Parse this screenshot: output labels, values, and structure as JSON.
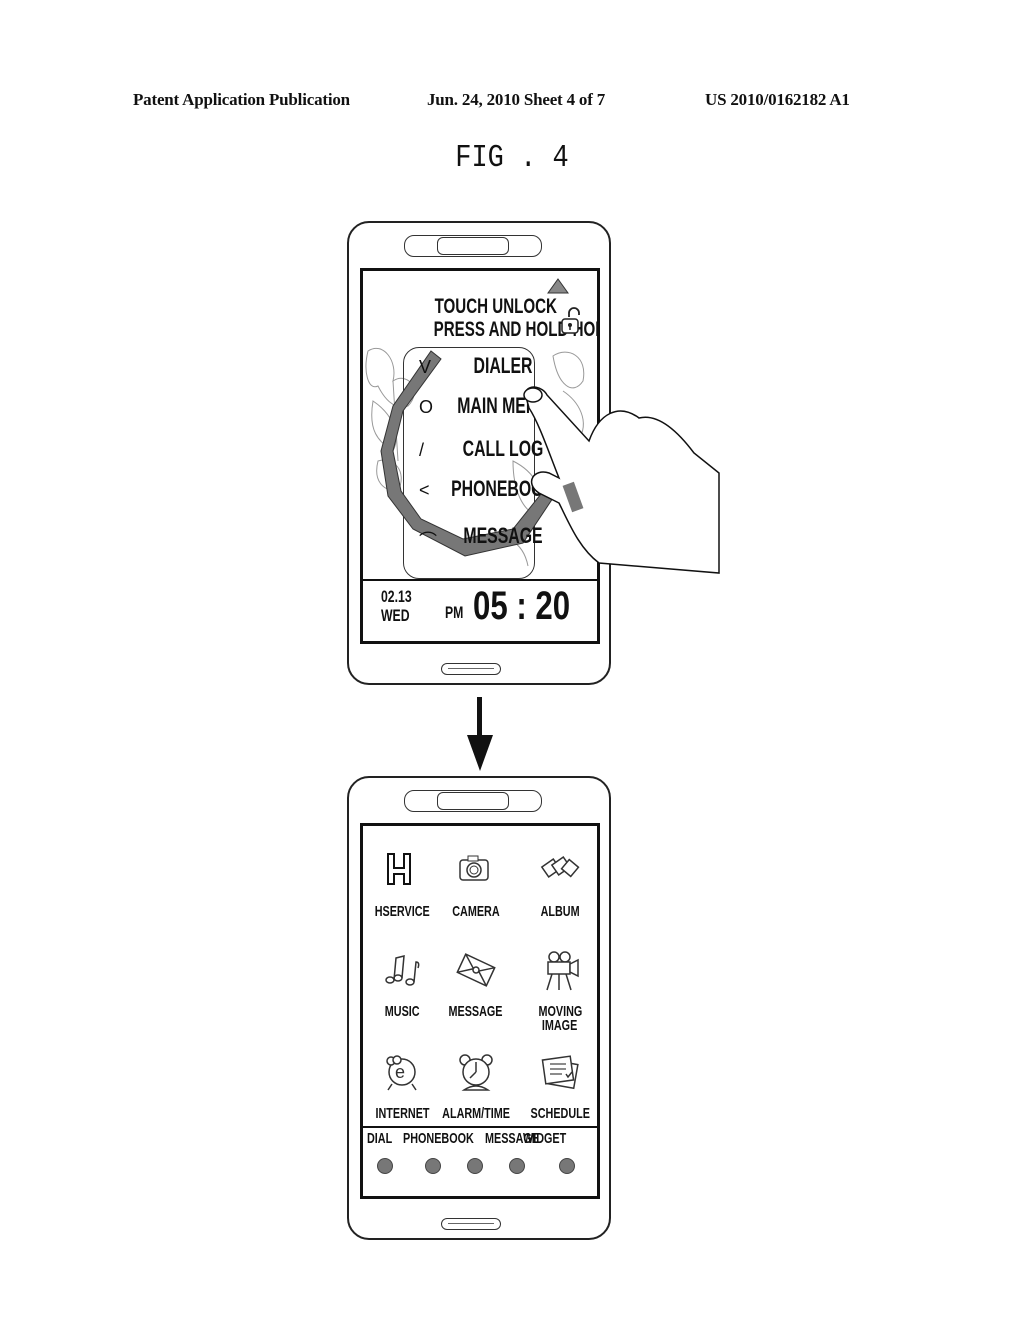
{
  "header": {
    "left": "Patent Application Publication",
    "center": "Jun. 24, 2010  Sheet 4 of 7",
    "right": "US 2010/0162182 A1"
  },
  "figure_label": "FIG . 4",
  "lock_screen": {
    "unlock_title": "TOUCH UNLOCK",
    "unlock_hint": "PRESS AND HOLD HOLD",
    "icons": [
      "up-triangle-icon",
      "unlock-padlock-icon"
    ],
    "menu_items": [
      {
        "gesture": "V",
        "label": "DIALER"
      },
      {
        "gesture": "O",
        "label": "MAIN MENU"
      },
      {
        "gesture": "/",
        "label": "CALL LOG"
      },
      {
        "gesture": "<",
        "label": "PHONEBOOK"
      },
      {
        "gesture": "⌒",
        "label": "MESSAGE"
      }
    ],
    "date": "02.13",
    "weekday": "WED",
    "ampm": "PM",
    "time": "05 : 20"
  },
  "transition_arrow": "down-arrow",
  "main_menu": {
    "apps": [
      {
        "label": "HSERVICE",
        "icon": "hservice-icon"
      },
      {
        "label": "CAMERA",
        "icon": "camera-icon"
      },
      {
        "label": "ALBUM",
        "icon": "album-icon"
      },
      {
        "label": "MUSIC",
        "icon": "music-icon"
      },
      {
        "label": "MESSAGE",
        "icon": "message-icon"
      },
      {
        "label": "MOVING IMAGE",
        "icon": "movie-camera-icon"
      },
      {
        "label": "INTERNET",
        "icon": "internet-icon"
      },
      {
        "label": "ALARM/TIME",
        "icon": "alarm-clock-icon"
      },
      {
        "label": "SCHEDULE",
        "icon": "schedule-icon"
      }
    ],
    "dock": [
      "DIAL",
      "PHONEBOOK",
      "MESSAGE",
      "WIDGET"
    ]
  }
}
